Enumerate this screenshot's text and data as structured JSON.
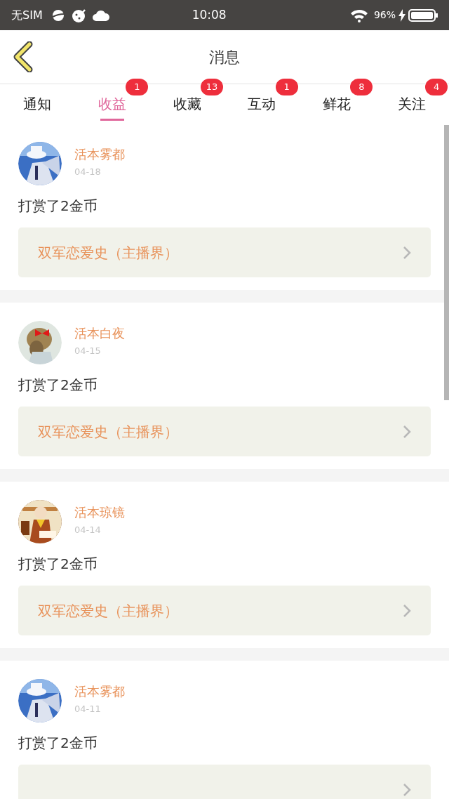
{
  "status_bar": {
    "carrier": "无SIM",
    "time": "10:08",
    "battery": "96%"
  },
  "header": {
    "title": "消息"
  },
  "tabs": [
    {
      "label": "通知",
      "selected": false
    },
    {
      "label": "收益",
      "selected": true,
      "badge": "1"
    },
    {
      "label": "收藏",
      "selected": false,
      "badge": "13"
    },
    {
      "label": "互动",
      "selected": false,
      "badge": "1"
    },
    {
      "label": "鲜花",
      "selected": false,
      "badge": "8"
    },
    {
      "label": "关注",
      "selected": false,
      "badge": "4"
    }
  ],
  "messages": [
    {
      "name": "活本雾都",
      "date": "04-18",
      "text": "打赏了2金币",
      "link": "双军恋爱史（主播界）"
    },
    {
      "name": "活本白夜",
      "date": "04-15",
      "text": "打赏了2金币",
      "link": "双军恋爱史（主播界）"
    },
    {
      "name": "活本琼镜",
      "date": "04-14",
      "text": "打赏了2金币",
      "link": "双军恋爱史（主播界）"
    },
    {
      "name": "活本雾都",
      "date": "04-11",
      "text": "打赏了2金币"
    }
  ]
}
